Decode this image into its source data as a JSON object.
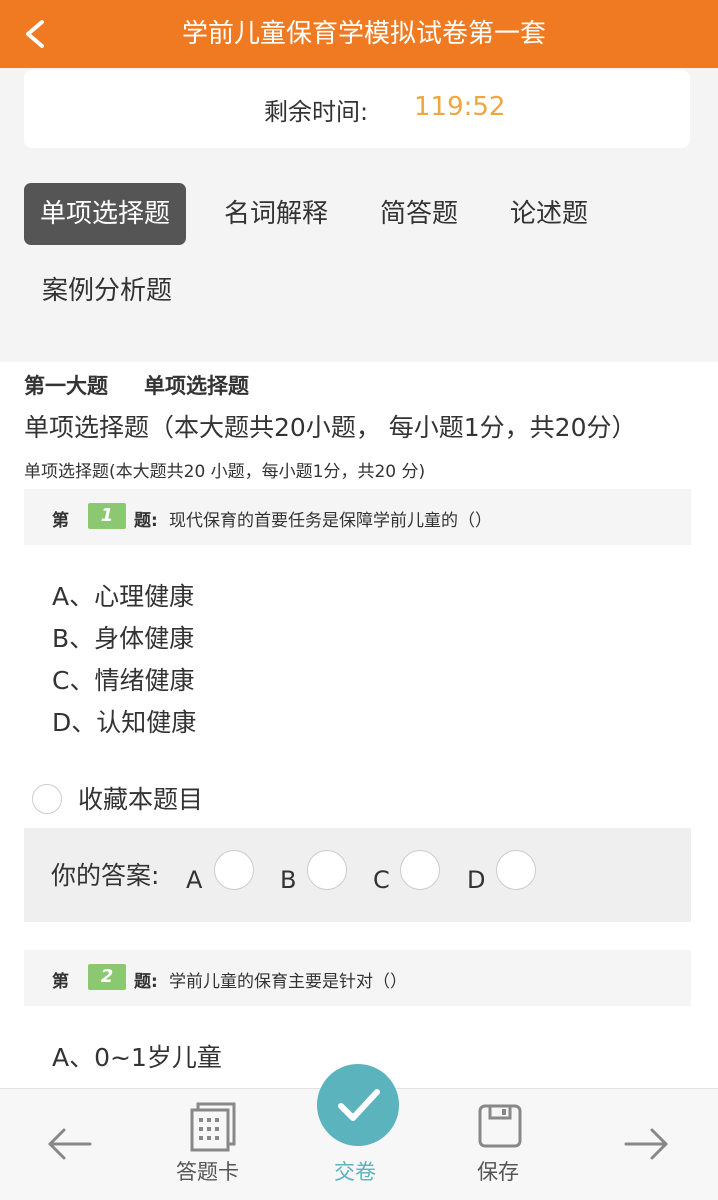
{
  "header": {
    "title": "学前儿童保育学模拟试卷第一套"
  },
  "timer": {
    "label": "剩余时间:",
    "value": "119:52"
  },
  "tabs": [
    {
      "label": "单项选择题",
      "active": true
    },
    {
      "label": "名词解释",
      "active": false
    },
    {
      "label": "简答题",
      "active": false
    },
    {
      "label": "论述题",
      "active": false
    },
    {
      "label": "案例分析题",
      "active": false
    }
  ],
  "section": {
    "part": "第一大题",
    "type": "单项选择题",
    "description": "单项选择题（本大题共20小题， 每小题1分，共20分）",
    "sub_description": "单项选择题(本大题共20 小题，每小题1分，共20 分)"
  },
  "questions": [
    {
      "prefix": "第",
      "number": "1",
      "suffix": "题:",
      "text": "现代保育的首要任务是保障学前儿童的（）",
      "options": [
        "A、心理健康",
        "B、身体健康",
        "C、情绪健康",
        "D、认知健康"
      ]
    },
    {
      "prefix": "第",
      "number": "2",
      "suffix": "题:",
      "text": "学前儿童的保育主要是针对（）",
      "options": [
        "A、0~1岁儿童"
      ]
    }
  ],
  "favorite": {
    "label": "收藏本题目"
  },
  "answer": {
    "label": "你的答案:",
    "choices": [
      "A",
      "B",
      "C",
      "D"
    ]
  },
  "bottom_nav": {
    "card_label": "答题卡",
    "submit_label": "交卷",
    "save_label": "保存"
  },
  "colors": {
    "header_bg": "#f07a22",
    "timer": "#f0a640",
    "question_number_badge": "#8bc871",
    "submit_accent": "#5ab3bd",
    "active_tab_bg": "#555555"
  }
}
